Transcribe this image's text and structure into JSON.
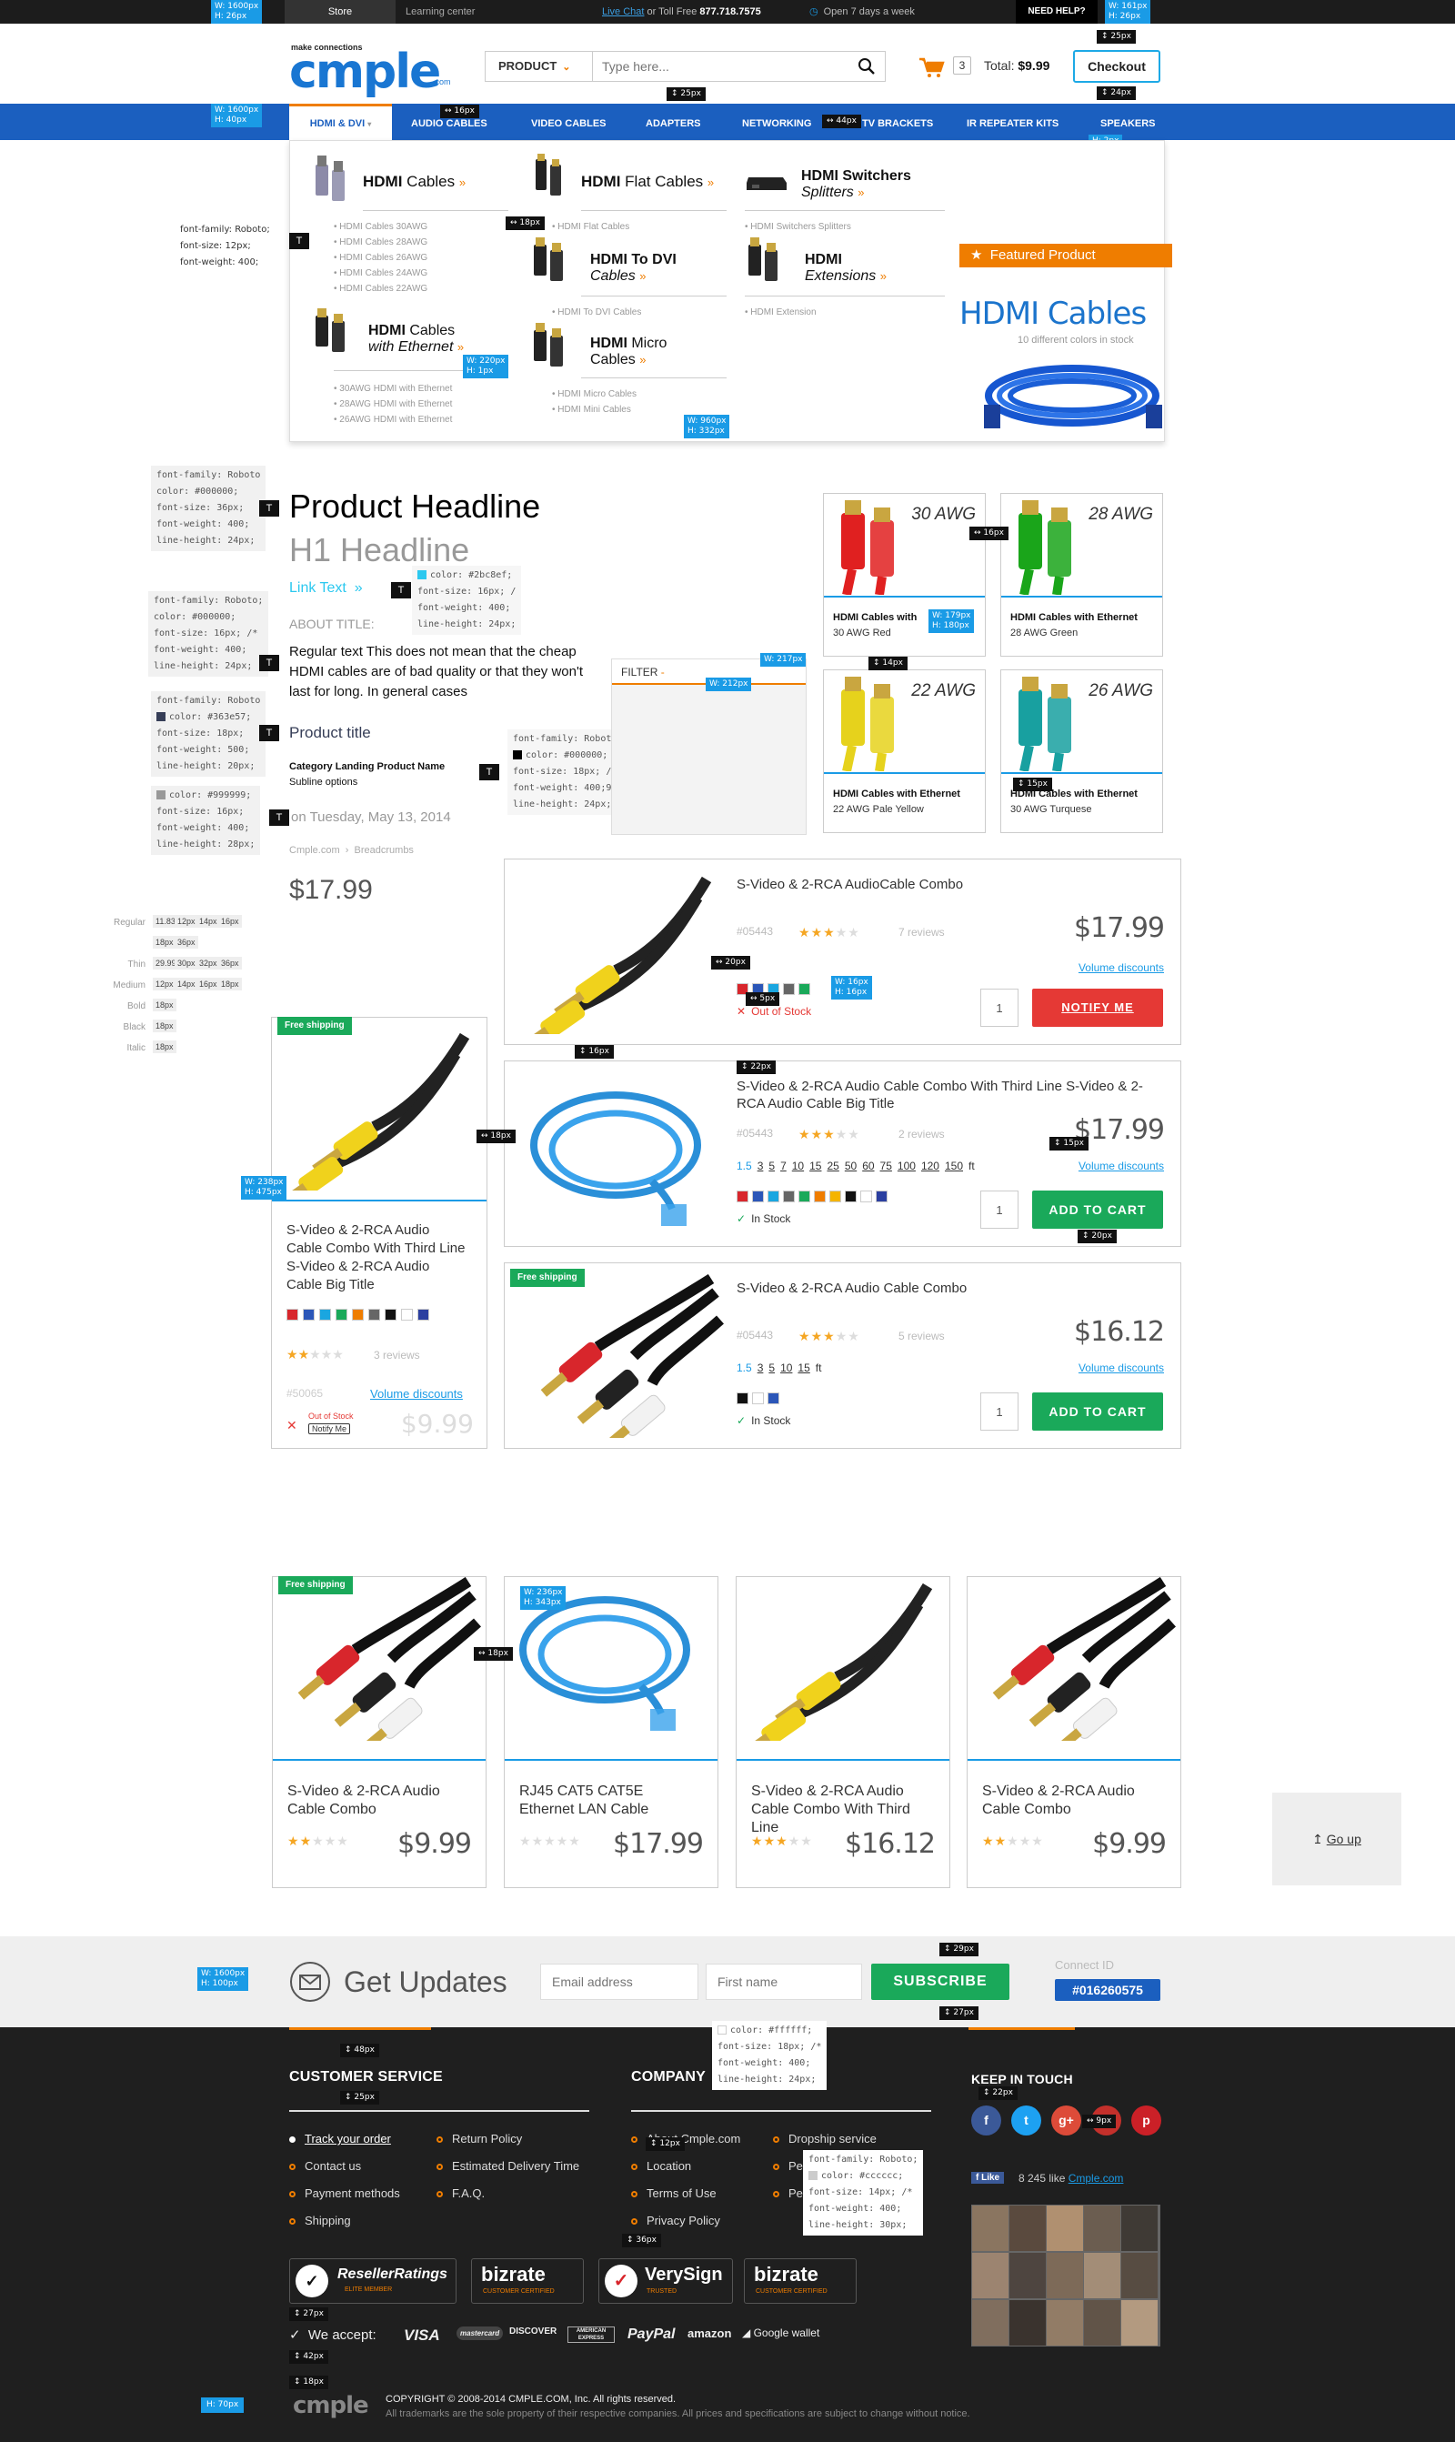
{
  "topbar": {
    "store": "Store",
    "learning": "Learning center",
    "live_chat": "Live Chat",
    "toll_free": " or Toll Free ",
    "phone": "877.718.7575",
    "open": "Open 7 days a week",
    "need_help": "NEED HELP?"
  },
  "header": {
    "logo_tag": "make connections",
    "logo": "cmple",
    "logo_com": ".com",
    "search_category": "PRODUCT",
    "search_placeholder": "Type here...",
    "cart_count": "3",
    "total_label": "Total:",
    "total_value": "$9.99",
    "checkout": "Checkout"
  },
  "nav": [
    "HDMI & DVI",
    "AUDIO CABLES",
    "VIDEO CABLES",
    "ADAPTERS",
    "NETWORKING",
    "TV BRACKETS",
    "IR REPEATER KITS",
    "SPEAKERS"
  ],
  "mega": {
    "hdmi_cables": {
      "title_bold": "HDMI",
      "title_rest": " Cables",
      "links": [
        "HDMI Cables 30AWG",
        "HDMI Cables 28AWG",
        "HDMI Cables 26AWG",
        "HDMI Cables 24AWG",
        "HDMI Cables 22AWG"
      ]
    },
    "hdmi_flat": {
      "title_bold": "HDMI",
      "title_rest": " Flat Cables",
      "links": [
        "HDMI Flat Cables"
      ]
    },
    "hdmi_switch": {
      "title_bold": "HDMI Switchers",
      "title_rest": "Splitters",
      "links": [
        "HDMI Switchers Splitters"
      ]
    },
    "hdmi_eth": {
      "title_bold": "HDMI",
      "title_b2": " Cables",
      "title_rest": "with Ethernet",
      "links": [
        "30AWG HDMI with Ethernet",
        "28AWG HDMI with Ethernet",
        "26AWG HDMI with Ethernet"
      ]
    },
    "hdmi_dvi": {
      "title_bold": "HDMI To DVI",
      "title_rest": "Cables",
      "links": [
        "HDMI To DVI Cables"
      ]
    },
    "hdmi_ext": {
      "title_bold": "HDMI",
      "title_rest": "Extensions",
      "links": [
        "HDMI Extension"
      ]
    },
    "hdmi_micro": {
      "title_bold": "HDMI",
      "title_b2": " Micro",
      "title_rest": "Cables",
      "links": [
        "HDMI Micro Cables",
        "HDMI Mini Cables"
      ]
    },
    "featured_label": "Featured Product",
    "featured_title": "HDMI Cables",
    "featured_sub": "10 different colors in stock"
  },
  "typography": {
    "product_headline": "Product Headline",
    "h1": "H1 Headline",
    "link_text": "Link Text",
    "about_title": "ABOUT TITLE:",
    "regular_text": "Regular text This does not mean that the cheap HDMI cables are of bad quality or that they won't last for long. In general cases",
    "product_title": "Product title",
    "category_title": "Category Landing Product Name",
    "subline": "Subline options",
    "date": "on Tuesday, May 13, 2014",
    "breadcrumb_1": "Cmple.com",
    "breadcrumb_2": "Breadcrumbs",
    "price": "$17.99",
    "filter": "FILTER"
  },
  "font_sizes": {
    "rows": [
      {
        "label": "Regular",
        "sizes": [
          "11.83px",
          "12px",
          "14px",
          "16px"
        ]
      },
      {
        "label": "",
        "sizes": [
          "18px",
          "36px"
        ]
      },
      {
        "label": "Thin",
        "sizes": [
          "29.99px",
          "30px",
          "32px",
          "36px"
        ]
      },
      {
        "label": "Medium",
        "sizes": [
          "12px",
          "14px",
          "16px",
          "18px"
        ]
      },
      {
        "label": "Bold",
        "sizes": [
          "18px"
        ]
      },
      {
        "label": "Black",
        "sizes": [
          "18px"
        ]
      },
      {
        "label": "Italic",
        "sizes": [
          "18px"
        ]
      }
    ]
  },
  "spec_notes": {
    "menu": [
      "font-family: Roboto;",
      "font-size: 12px;",
      "font-weight: 400;"
    ],
    "headline": [
      "font-family: Roboto",
      "color: #000000;",
      "font-size: 36px;",
      "font-weight: 400;",
      "line-height: 24px;"
    ],
    "link": [
      "color: #2bc8ef;",
      "font-size: 16px; /",
      "font-weight: 400;",
      "line-height: 24px;"
    ],
    "regular": [
      "font-family: Roboto;",
      "color: #000000;",
      "font-size: 16px; /*",
      "font-weight: 400;",
      "line-height: 24px;"
    ],
    "product_title": [
      "font-family: Roboto",
      "color: #363e57;",
      "font-size: 18px;",
      "font-weight: 500;",
      "line-height: 20px;"
    ],
    "category": [
      "font-family: Roboto",
      "color: #000000;",
      "font-size: 18px; /*",
      "font-weight: 400;900;",
      "line-height: 24px;"
    ],
    "date": [
      "color: #999999;",
      "font-size: 16px;",
      "font-weight: 400;",
      "line-height: 28px;"
    ],
    "footer_title": [
      "color: #ffffff;",
      "font-size: 18px; /*",
      "font-weight: 400;",
      "line-height: 24px;"
    ],
    "footer_link": [
      "font-family: Roboto;",
      "color: #cccccc;",
      "font-size: 14px; /*",
      "font-weight: 400;",
      "line-height: 30px;"
    ]
  },
  "measures": {
    "w1600h26": [
      "W: 1600px",
      "H: 26px"
    ],
    "w161h26": [
      "W: 161px",
      "H: 26px"
    ],
    "p25a": "25px",
    "p25b": "25px",
    "p24": "24px",
    "w1600h40": [
      "W: 1600px",
      "H: 40px"
    ],
    "p16": "16px",
    "p44": "44px",
    "p2": "H: 2px",
    "p18": "18px",
    "w220h1": [
      "W: 220px",
      "H: 1px"
    ],
    "w960h332": [
      "W: 960px",
      "H: 332px"
    ],
    "p16b": "16px",
    "w179h180": [
      "W: 179px",
      "H: 180px"
    ],
    "p14": "14px",
    "w217": "W: 217px",
    "w212": "W: 212px",
    "p15": "15px",
    "p20": "20px",
    "p5": "5px",
    "w16h16": [
      "W: 16px",
      "H: 16px"
    ],
    "p16c": "16px",
    "p22": "22px",
    "p18b": "18px",
    "w238h475": [
      "W: 238px",
      "H: 475px"
    ],
    "p15b": "15px",
    "p20b": "20px",
    "w236h343": [
      "W: 236px",
      "H: 343px"
    ],
    "p18c": "18px",
    "p29": "29px",
    "p27": "27px",
    "w1600h100": [
      "W: 1600px",
      "H: 100px"
    ],
    "p48": "48px",
    "p25c": "25px",
    "p22b": "22px",
    "p9": "9px",
    "p12": "12px",
    "p36": "36px",
    "p27b": "27px",
    "p42": "42px",
    "p18d": "18px",
    "h70": "H: 70px"
  },
  "awg_tiles": [
    {
      "awg": "30 AWG",
      "name": "HDMI Cables with",
      "sub": "30 AWG Red",
      "color": "#e02020"
    },
    {
      "awg": "28 AWG",
      "name": "HDMI Cables with Ethernet",
      "sub": "28 AWG Green",
      "color": "#1aa51a"
    },
    {
      "awg": "22 AWG",
      "name": "HDMI Cables with Ethernet",
      "sub": "22 AWG Pale Yellow",
      "color": "#e6d21c"
    },
    {
      "awg": "26 AWG",
      "name": "HDMI Cables with Ethernet",
      "sub": "30 AWG Turquese",
      "color": "#18a0a0"
    }
  ],
  "list_products": [
    {
      "name": "S-Video & 2-RCA AudioCable Combo",
      "sku": "#05443",
      "stars": 3,
      "reviews": "7 reviews",
      "price": "$17.99",
      "volume": "Volume discounts",
      "qty": "1",
      "button": "NOTIFY ME",
      "stock": "Out of Stock",
      "swatches": [
        "#d8262c",
        "#2b56b8",
        "#1aa6e0",
        "#666666",
        "#1aa95a"
      ]
    },
    {
      "name": "S-Video & 2-RCA Audio Cable Combo With Third Line S-Video & 2-RCA Audio Cable Big Title",
      "sku": "#05443",
      "stars": 3,
      "reviews": "2 reviews",
      "price": "$17.99",
      "volume": "Volume discounts",
      "qty": "1",
      "button": "ADD TO CART",
      "stock": "In Stock",
      "sizes": [
        "1.5",
        "3",
        "5",
        "7",
        "10",
        "15",
        "25",
        "50",
        "60",
        "75",
        "100",
        "120",
        "150"
      ],
      "unit": "ft",
      "swatches": [
        "#d8262c",
        "#2b56b8",
        "#1aa6e0",
        "#666666",
        "#1aa95a",
        "#ef7d00",
        "#f5b400",
        "#111111",
        "#ffffff",
        "#2b3fa0"
      ]
    },
    {
      "name": "S-Video & 2-RCA Audio Cable Combo",
      "sku": "#05443",
      "stars": 3,
      "reviews": "5 reviews",
      "price": "$16.12",
      "volume": "Volume discounts",
      "qty": "1",
      "button": "ADD TO CART",
      "stock": "In Stock",
      "sizes": [
        "1.5",
        "3",
        "5",
        "10",
        "15"
      ],
      "unit": "ft",
      "swatches": [
        "#111111",
        "#ffffff",
        "#2b56b8"
      ],
      "free": "Free shipping"
    }
  ],
  "tall_card": {
    "free": "Free shipping",
    "name": "S-Video & 2-RCA Audio Cable Combo With Third Line S-Video & 2-RCA Audio Cable Big Title",
    "stars": 2,
    "reviews": "3 reviews",
    "sku": "#50065",
    "volume": "Volume discounts",
    "out": "Out of Stock",
    "notify": "Notify Me",
    "price": "$9.99",
    "swatches": [
      "#d8262c",
      "#2b56b8",
      "#1aa6e0",
      "#1aa95a",
      "#ef7d00",
      "#666666",
      "#111111",
      "#ffffff",
      "#2b3fa0"
    ]
  },
  "grid_products": [
    {
      "name": "S-Video & 2-RCA Audio Cable Combo",
      "stars": 2,
      "price": "$9.99",
      "free": "Free shipping"
    },
    {
      "name": "RJ45 CAT5 CAT5E Ethernet LAN Cable",
      "stars": 0,
      "price": "$17.99"
    },
    {
      "name": "S-Video & 2-RCA Audio Cable Combo With Third Line",
      "stars": 3,
      "price": "$16.12"
    },
    {
      "name": "S-Video & 2-RCA Audio Cable Combo",
      "stars": 2,
      "price": "$9.99"
    }
  ],
  "go_up": "Go up",
  "updates": {
    "title": "Get Updates",
    "email_placeholder": "Email address",
    "name_placeholder": "First name",
    "subscribe": "SUBSCRIBE",
    "connect_label": "Connect ID",
    "connect_id": "#016260575"
  },
  "footer": {
    "customer_service": "CUSTOMER SERVICE",
    "company": "COMPANY",
    "keep_in_touch": "KEEP IN TOUCH",
    "cs_links": [
      "Track your order",
      "Contact us",
      "Payment methods",
      "Shipping"
    ],
    "cs_links2": [
      "Return Policy",
      "Estimated Delivery Time",
      "F.A.Q."
    ],
    "co_links": [
      "About Cmple.com",
      "Location",
      "Terms of Use",
      "Privacy Policy"
    ],
    "co_links2": [
      "Dropship service",
      "Pe",
      "Pe"
    ],
    "fb_like": "Like",
    "fb_count": "8 245 like",
    "fb_page": "Cmple.com",
    "certs": [
      "ResellerRatings",
      "bizrate",
      "VerySign",
      "bizrate"
    ],
    "cert_subs": [
      "ELITE MEMBER",
      "CUSTOMER CERTIFIED",
      "TRUSTED",
      "CUSTOMER CERTIFIED"
    ],
    "we_accept": "We accept:",
    "payments": [
      "VISA",
      "mastercard",
      "DISCOVER",
      "AMERICAN EXPRESS",
      "PayPal",
      "amazon",
      "Google wallet"
    ],
    "copyright": "COPYRIGHT © 2008-2014 CMPLE.COM, Inc. All rights reserved.",
    "trademark": "All trademarks are the sole property of their respective companies. All prices and specifications are subject to change without notice.",
    "logo": "cmple"
  },
  "colors": {
    "brand_blue": "#1b5fbf",
    "accent_orange": "#ef7d00",
    "green": "#1aa95a",
    "red": "#e53935",
    "link": "#1a9be6"
  }
}
